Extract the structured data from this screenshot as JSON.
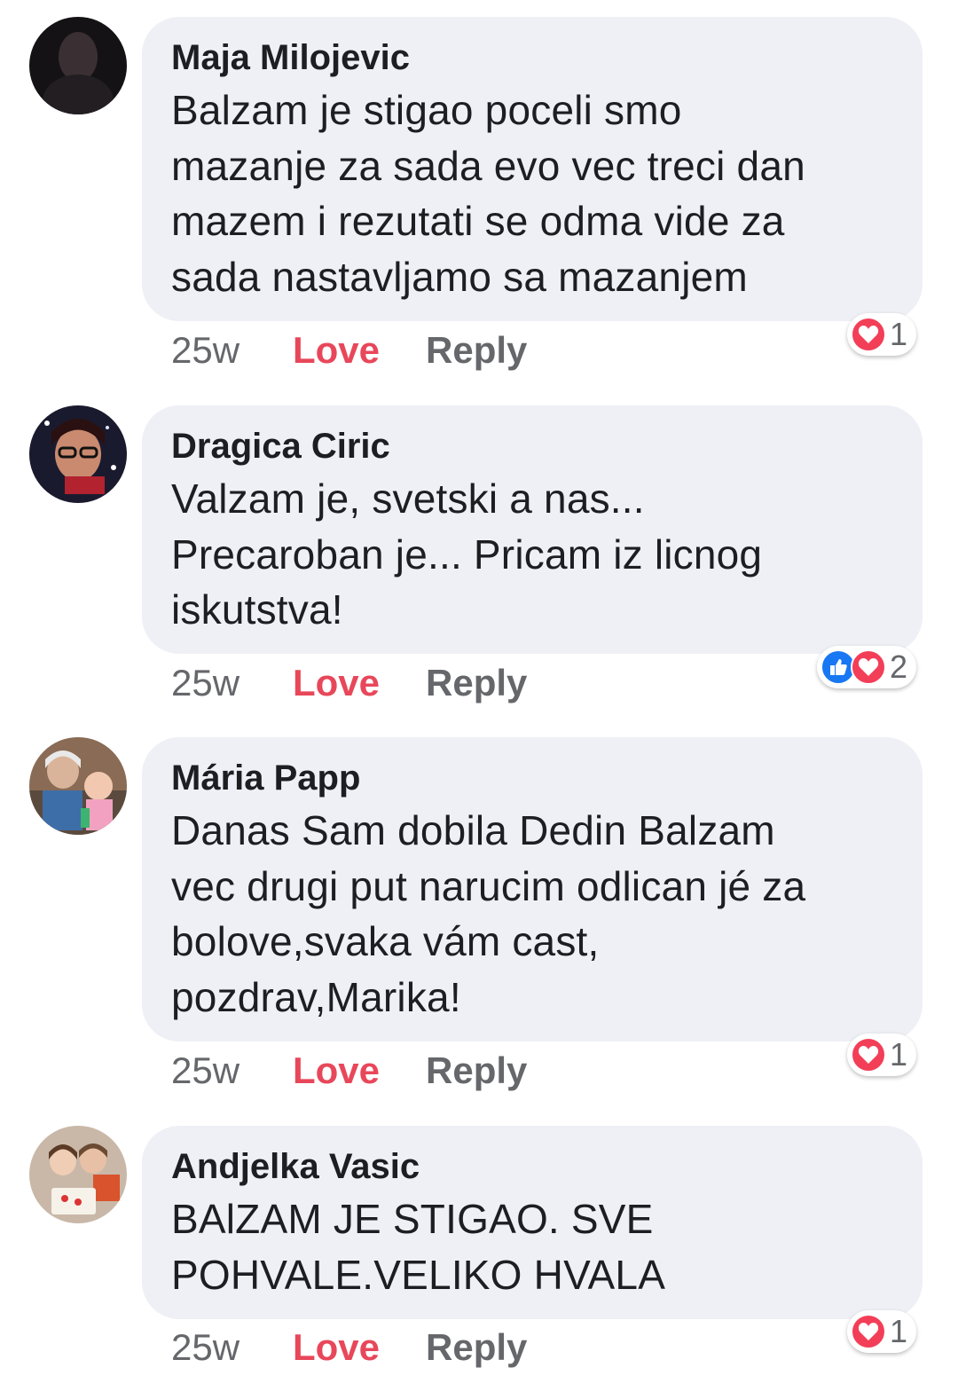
{
  "comments": [
    {
      "author": "Maja Milojevic",
      "text_lines": [
        "Balzam je stigao poceli smo",
        "mazanje za sada evo vec treci dan",
        "mazem i rezutati se odma vide za",
        "sada nastavljamo sa mazanjem"
      ],
      "time": "25w",
      "love_label": "Love",
      "reply_label": "Reply",
      "reaction_count": "1",
      "reaction_icons": [
        "heart-icon"
      ]
    },
    {
      "author": "Dragica Ciric",
      "text_lines": [
        "Valzam je, svetski a nas...",
        "Precaroban je... Pricam iz licnog",
        "iskutstva!"
      ],
      "time": "25w",
      "love_label": "Love",
      "reply_label": "Reply",
      "reaction_count": "2",
      "reaction_icons": [
        "like-icon",
        "heart-icon"
      ]
    },
    {
      "author": "Mária Papp",
      "text_lines": [
        "Danas Sam dobila Dedin Balzam",
        "vec drugi put narucim odlican jé za",
        "bolove,svaka vám cast,",
        "pozdrav,Marika!"
      ],
      "time": "25w",
      "love_label": "Love",
      "reply_label": "Reply",
      "reaction_count": "1",
      "reaction_icons": [
        "heart-icon"
      ]
    },
    {
      "author": "Andjelka Vasic",
      "text_lines": [
        "BAlZAM JE STIGAO. SVE",
        "POHVALE.VELIKO HVALA"
      ],
      "time": "25w",
      "love_label": "Love",
      "reply_label": "Reply",
      "reaction_count": "1",
      "reaction_icons": [
        "heart-icon"
      ]
    }
  ],
  "colors": {
    "bubble": "#eff0f5",
    "love": "#e8475a",
    "muted": "#65676b",
    "heart": "#f33e58",
    "like": "#1877f2"
  }
}
